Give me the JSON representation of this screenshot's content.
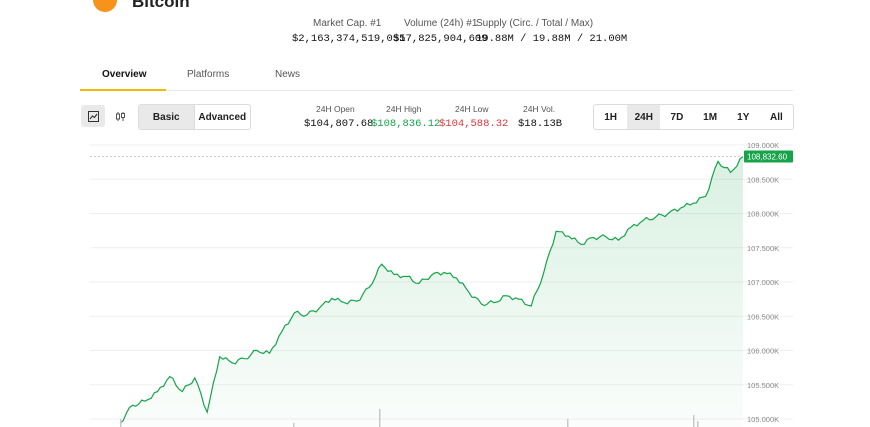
{
  "header": {
    "coin_name": "Bitcoin"
  },
  "summary": {
    "market_cap_label": "Market Cap. #1",
    "market_cap_value": "$2,163,374,519,055",
    "volume_label": "Volume (24h) #1",
    "volume_value": "$17,825,904,609",
    "supply_label": "Supply (Circ. / Total / Max)",
    "supply_value": "19.88M / 19.88M / 21.00M"
  },
  "tabs": [
    {
      "label": "Overview"
    },
    {
      "label": "Platforms"
    },
    {
      "label": "News"
    }
  ],
  "toolbar": {
    "line_icon": "line-chart-icon",
    "candle_icon": "candlestick-icon",
    "basic_label": "Basic",
    "advanced_label": "Advanced"
  },
  "stats": {
    "open_label": "24H Open",
    "open_value": "$104,807.68",
    "high_label": "24H High",
    "high_value": "$108,836.12",
    "low_label": "24H Low",
    "low_value": "$104,588.32",
    "vol_label": "24H Vol.",
    "vol_value": "$18.13B"
  },
  "ranges": [
    "1H",
    "24H",
    "7D",
    "1M",
    "1Y",
    "All"
  ],
  "colors": {
    "up": "#16a34a",
    "down": "#e0353b",
    "accent": "#f0b90b",
    "bitcoin": "#f7931a"
  },
  "chart_data": {
    "type": "area",
    "yticks": [
      "105.000K",
      "105.500K",
      "106.000K",
      "106.500K",
      "107.000K",
      "107.500K",
      "108.000K",
      "108.500K",
      "109.000K"
    ],
    "ylim": [
      104950,
      109050
    ],
    "current_price_label": "108,832.60",
    "current_price": 108832.6,
    "x": [
      0,
      2,
      4,
      6,
      8,
      10,
      12,
      14,
      16,
      18,
      20,
      22,
      24,
      26,
      28,
      30,
      32,
      34,
      36,
      38,
      40,
      42,
      44,
      46,
      48,
      50,
      52,
      54,
      56,
      58,
      60,
      62,
      64,
      66,
      68,
      70,
      72,
      74,
      76,
      78,
      80,
      82,
      84,
      86,
      88,
      90,
      92,
      94,
      96,
      98,
      100
    ],
    "values": [
      104940,
      105200,
      105260,
      105400,
      105620,
      105400,
      105600,
      105100,
      105910,
      105820,
      105880,
      106000,
      105960,
      106280,
      106550,
      106520,
      106620,
      106760,
      106700,
      106720,
      106920,
      107260,
      107110,
      107080,
      106980,
      107100,
      107140,
      107060,
      106850,
      106680,
      106700,
      106800,
      106750,
      106650,
      107130,
      107740,
      107670,
      107550,
      107650,
      107660,
      107610,
      107800,
      107900,
      107950,
      108000,
      108080,
      108150,
      108250,
      108760,
      108600,
      108832.6
    ]
  }
}
